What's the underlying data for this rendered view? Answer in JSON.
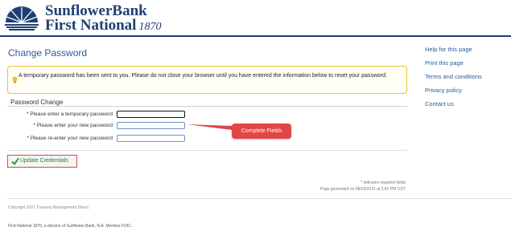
{
  "header": {
    "brand_line1": "SunflowerBank",
    "brand_line2": "First National",
    "brand_year": "1870",
    "logo_icon": "sunrise-logo-icon",
    "colors": {
      "brand": "#1f3f73",
      "accent": "#2c5b97"
    }
  },
  "page": {
    "title": "Change Password"
  },
  "notice": {
    "icon": "lightbulb-icon",
    "text": "A temporary password has been sent to you. Please do not close your browser until you have entered the information below to reset your password."
  },
  "form": {
    "section_title": "Password Change",
    "fields": [
      {
        "label": "* Please enter a temporary password",
        "value": ""
      },
      {
        "label": "* Please enter your new password",
        "value": ""
      },
      {
        "label": "* Please re-enter your new password",
        "value": ""
      }
    ],
    "annotation": "Complete Fields",
    "submit_label": "Update Credentials",
    "submit_icon": "checkmark-icon"
  },
  "footnotes": {
    "required": "* indicates required fields",
    "generated": "Page generated on 08/03/2021 at 2:41 PM CDT"
  },
  "footer": {
    "copyright": "Copyright 2021 Treasury Management Direct.",
    "member": "First National 1870, a division of Sunflower Bank, N.A. Member FDIC."
  },
  "sidebar": {
    "links": [
      {
        "label": "Help for this page"
      },
      {
        "label": "Print this page"
      },
      {
        "label": "Terms and conditions"
      },
      {
        "label": "Privacy policy"
      },
      {
        "label": "Contact us"
      }
    ]
  }
}
